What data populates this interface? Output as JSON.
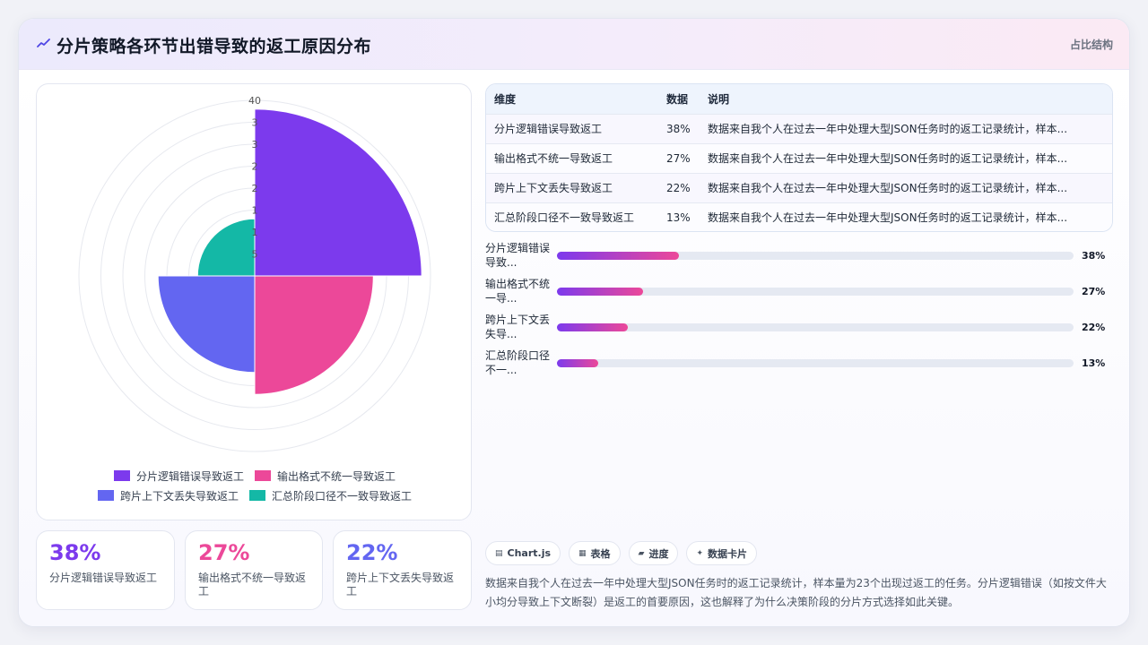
{
  "header": {
    "title": "分片策略各环节出错导致的返工原因分布",
    "tag": "占比结构",
    "icon": "trend-line-icon"
  },
  "colors": {
    "purple": "#7c3aed",
    "pink": "#ec4899",
    "indigo": "#6366f1",
    "teal": "#14b8a6"
  },
  "chart_data": {
    "type": "polarArea",
    "categories": [
      "分片逻辑错误导致返工",
      "输出格式不统一导致返工",
      "跨片上下文丢失导致返工",
      "汇总阶段口径不一致导致返工"
    ],
    "values": [
      38,
      27,
      22,
      13
    ],
    "colors": [
      "#7c3aed",
      "#ec4899",
      "#6366f1",
      "#14b8a6"
    ],
    "rmax": 40,
    "ticks": [
      5,
      10,
      15,
      20,
      25,
      30,
      35,
      40
    ],
    "tick_labels": [
      "5",
      "1",
      "1",
      "2",
      "2",
      "3",
      "3",
      "40"
    ],
    "legend_position": "bottom",
    "grid": true
  },
  "stats": [
    {
      "value": "38%",
      "label": "分片逻辑错误导致返工",
      "color": "#7c3aed"
    },
    {
      "value": "27%",
      "label": "输出格式不统一导致返工",
      "color": "#ec4899"
    },
    {
      "value": "22%",
      "label": "跨片上下文丢失导致返工",
      "color": "#6366f1"
    }
  ],
  "table": {
    "headers": [
      "维度",
      "数据",
      "说明"
    ],
    "rows": [
      [
        "分片逻辑错误导致返工",
        "38%",
        "数据来自我个人在过去一年中处理大型JSON任务时的返工记录统计，样本..."
      ],
      [
        "输出格式不统一导致返工",
        "27%",
        "数据来自我个人在过去一年中处理大型JSON任务时的返工记录统计，样本..."
      ],
      [
        "跨片上下文丢失导致返工",
        "22%",
        "数据来自我个人在过去一年中处理大型JSON任务时的返工记录统计，样本..."
      ],
      [
        "汇总阶段口径不一致导致返工",
        "13%",
        "数据来自我个人在过去一年中处理大型JSON任务时的返工记录统计，样本..."
      ]
    ]
  },
  "bars": [
    {
      "label": "分片逻辑错误导致...",
      "value": 38,
      "text": "38%"
    },
    {
      "label": "输出格式不统一导...",
      "value": 27,
      "text": "27%"
    },
    {
      "label": "跨片上下文丢失导...",
      "value": 22,
      "text": "22%"
    },
    {
      "label": "汇总阶段口径不一...",
      "value": 13,
      "text": "13%"
    }
  ],
  "chips": [
    {
      "icon": "▤",
      "label": "Chart.js"
    },
    {
      "icon": "▦",
      "label": "表格"
    },
    {
      "icon": "▰",
      "label": "进度"
    },
    {
      "icon": "✦",
      "label": "数据卡片"
    }
  ],
  "description": "数据来自我个人在过去一年中处理大型JSON任务时的返工记录统计，样本量为23个出现过返工的任务。分片逻辑错误（如按文件大小均分导致上下文断裂）是返工的首要原因，这也解释了为什么决策阶段的分片方式选择如此关键。"
}
